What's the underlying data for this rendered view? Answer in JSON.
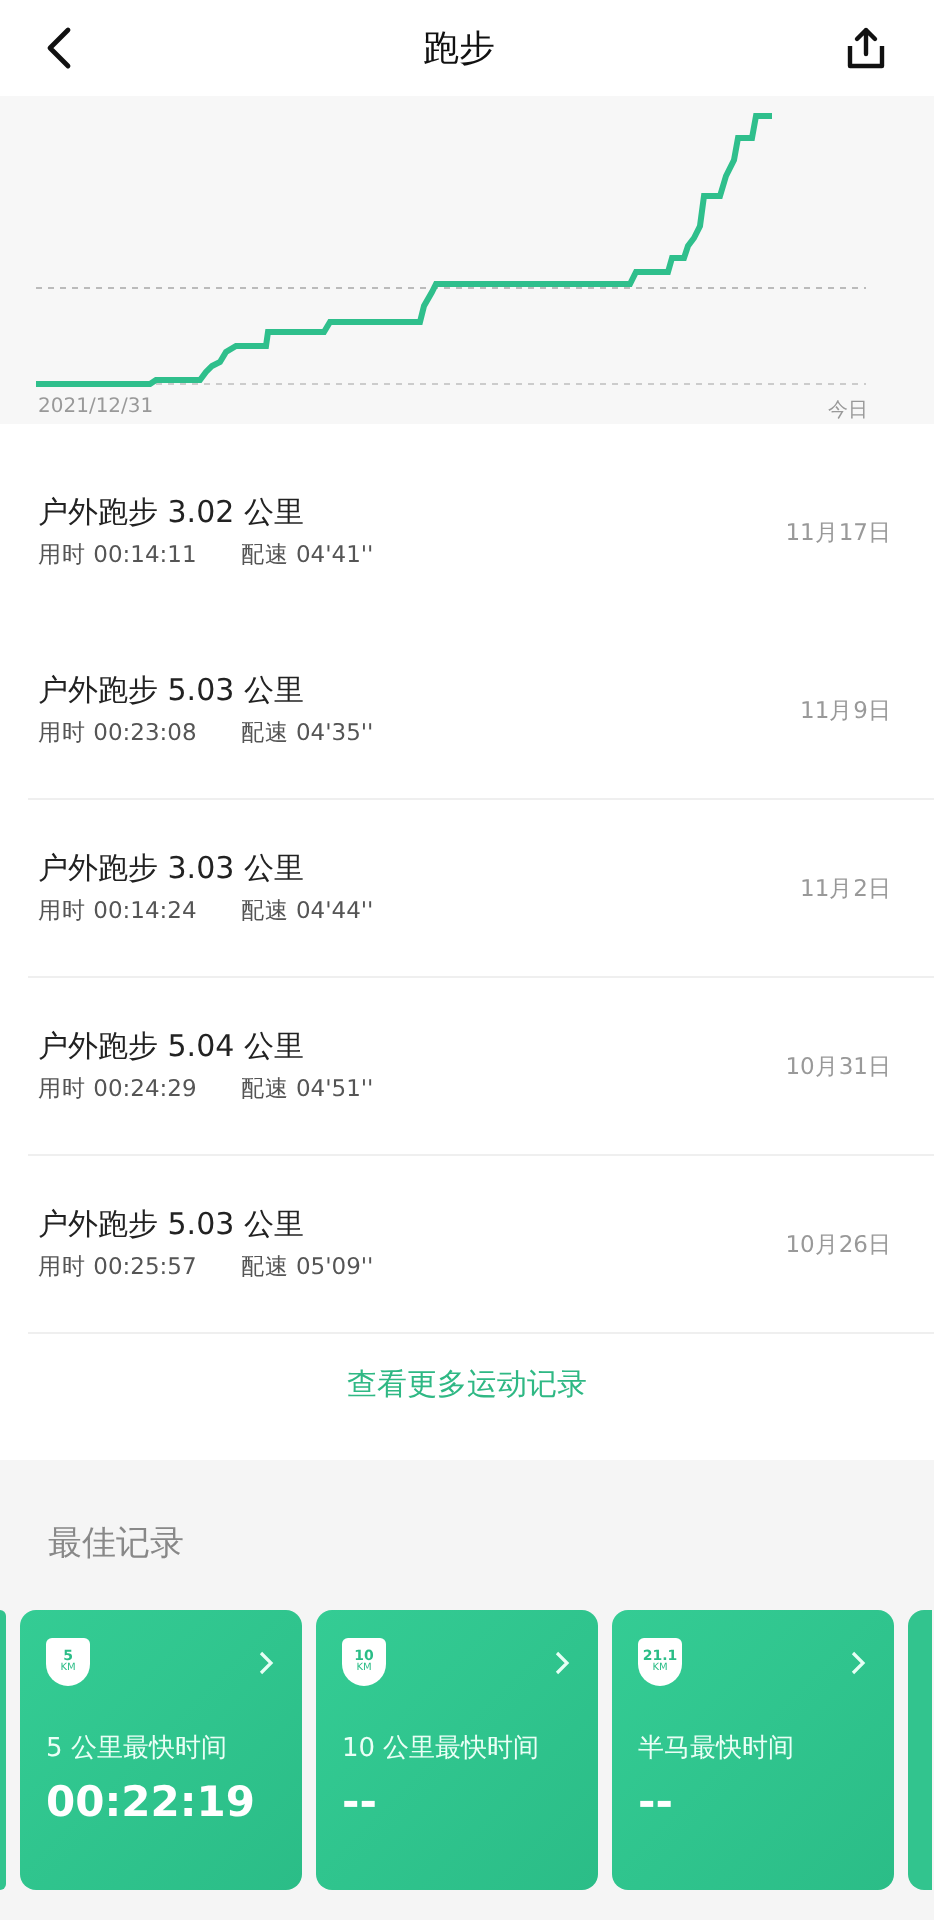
{
  "nav": {
    "title": "跑步"
  },
  "chart": {
    "start_label": "2021/12/31",
    "end_label": "今日"
  },
  "records": [
    {
      "title": "户外跑步 3.02 公里",
      "duration": "用时 00:14:11",
      "pace": "配速 04'41''",
      "date": "11月17日",
      "divider": false
    },
    {
      "title": "户外跑步 5.03 公里",
      "duration": "用时 00:23:08",
      "pace": "配速 04'35''",
      "date": "11月9日",
      "divider": true
    },
    {
      "title": "户外跑步 3.03 公里",
      "duration": "用时 00:14:24",
      "pace": "配速 04'44''",
      "date": "11月2日",
      "divider": true
    },
    {
      "title": "户外跑步 5.04 公里",
      "duration": "用时 00:24:29",
      "pace": "配速 04'51''",
      "date": "10月31日",
      "divider": true
    },
    {
      "title": "户外跑步 5.03 公里",
      "duration": "用时 00:25:57",
      "pace": "配速 05'09''",
      "date": "10月26日",
      "divider": true
    }
  ],
  "more_link": "查看更多运动记录",
  "best": {
    "heading": "最佳记录",
    "cards": [
      {
        "badge": "5",
        "unit": "KM",
        "label": "5 公里最快时间",
        "value": "00:22:19"
      },
      {
        "badge": "10",
        "unit": "KM",
        "label": "10 公里最快时间",
        "value": "--"
      },
      {
        "badge": "21.1",
        "unit": "KM",
        "label": "半马最快时间",
        "value": "--"
      }
    ]
  }
}
